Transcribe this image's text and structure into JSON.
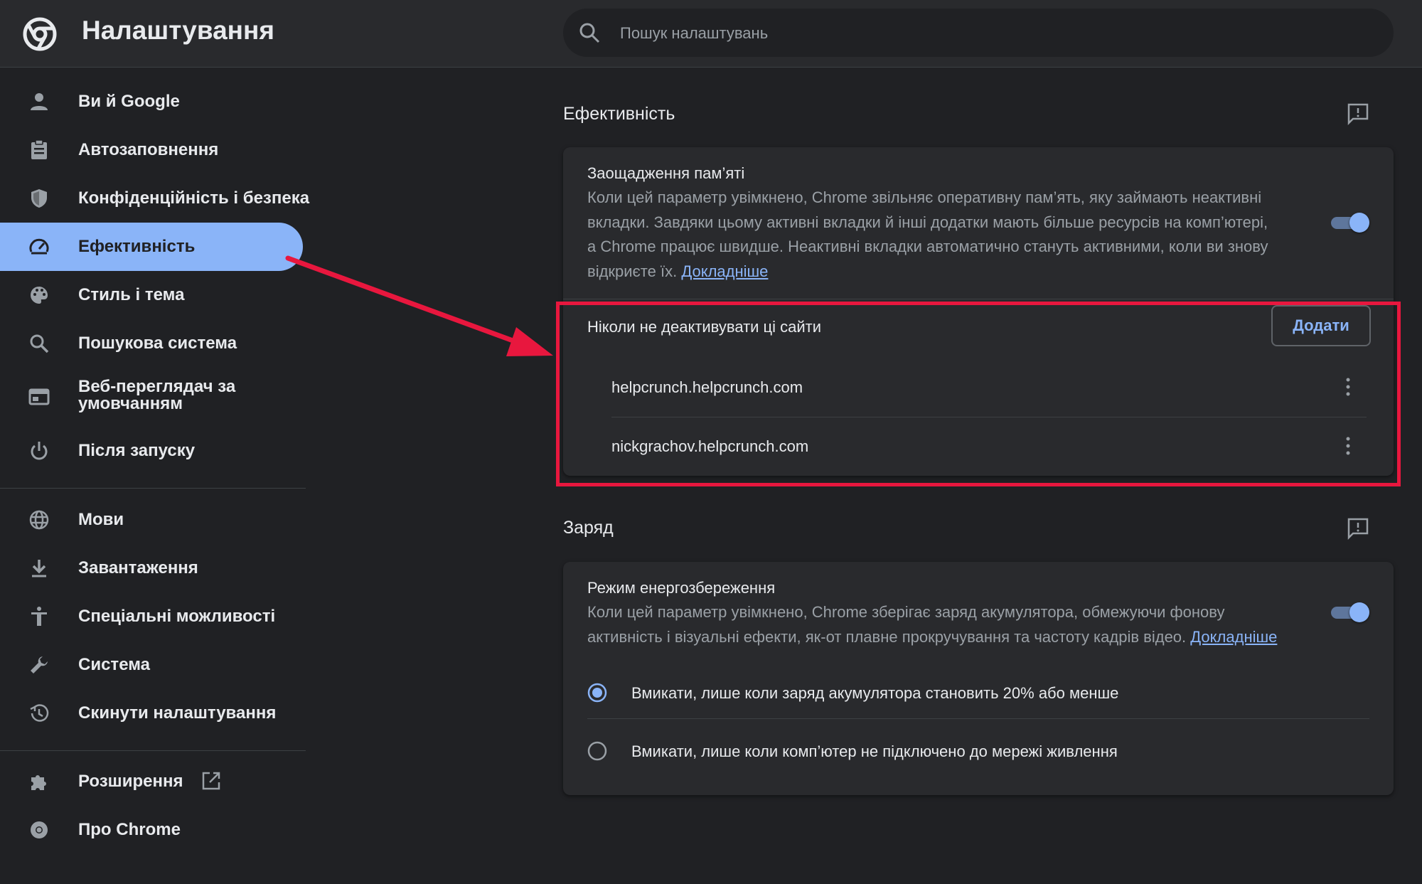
{
  "header": {
    "title": "Налаштування",
    "search_placeholder": "Пошук налаштувань"
  },
  "sidebar": {
    "items": [
      {
        "label": "Ви й Google",
        "icon": "person-icon"
      },
      {
        "label": "Автозаповнення",
        "icon": "clipboard-icon"
      },
      {
        "label": "Конфіденційність і безпека",
        "icon": "shield-icon"
      },
      {
        "label": "Ефективність",
        "icon": "speedometer-icon",
        "active": true
      },
      {
        "label": "Стиль і тема",
        "icon": "palette-icon"
      },
      {
        "label": "Пошукова система",
        "icon": "search-icon"
      },
      {
        "label": "Веб-переглядач за умовчанням",
        "icon": "browser-window-icon"
      },
      {
        "label": "Після запуску",
        "icon": "power-icon"
      },
      {
        "label": "Мови",
        "icon": "globe-icon"
      },
      {
        "label": "Завантаження",
        "icon": "download-icon"
      },
      {
        "label": "Спеціальні можливості",
        "icon": "accessibility-icon"
      },
      {
        "label": "Система",
        "icon": "wrench-icon"
      },
      {
        "label": "Скинути налаштування",
        "icon": "history-icon"
      },
      {
        "label": "Розширення",
        "icon": "puzzle-icon"
      },
      {
        "label": "Про Chrome",
        "icon": "chrome-logo-icon"
      }
    ]
  },
  "performance": {
    "section_title": "Ефективність",
    "memory_saver": {
      "title": "Заощадження пам’яті",
      "desc_lines": [
        "Коли цей параметр увімкнено, Chrome звільняє оперативну пам’ять, яку займають неактивні",
        "вкладки. Завдяки цьому активні вкладки й інші додатки мають більше ресурсів на комп’ютері,",
        "а Chrome працює швидше. Неактивні вкладки автоматично стануть активними, коли ви знову",
        "відкриєте їх."
      ],
      "learn_more": "Докладніше",
      "enabled": true
    },
    "never_sleep": {
      "title": "Ніколи не деактивувати ці сайти",
      "add_button": "Додати",
      "sites": [
        "helpcrunch.helpcrunch.com",
        "nickgrachov.helpcrunch.com"
      ]
    }
  },
  "battery": {
    "section_title": "Заряд",
    "energy_saver": {
      "title": "Режим енергозбереження",
      "desc_lines": [
        "Коли цей параметр увімкнено, Chrome зберігає заряд акумулятора, обмежуючи фонову",
        "активність і візуальні ефекти, як-от плавне прокручування та частоту кадрів відео."
      ],
      "learn_more": "Докладніше",
      "enabled": true
    },
    "options": [
      {
        "label": "Вмикати, лише коли заряд акумулятора становить 20% або менше",
        "selected": true
      },
      {
        "label": "Вмикати, лише коли комп’ютер не підключено до мережі живлення",
        "selected": false
      }
    ]
  },
  "colors": {
    "accent": "#8ab4f8",
    "highlight": "#e8173e",
    "background": "#202124",
    "surface": "#292a2d"
  }
}
